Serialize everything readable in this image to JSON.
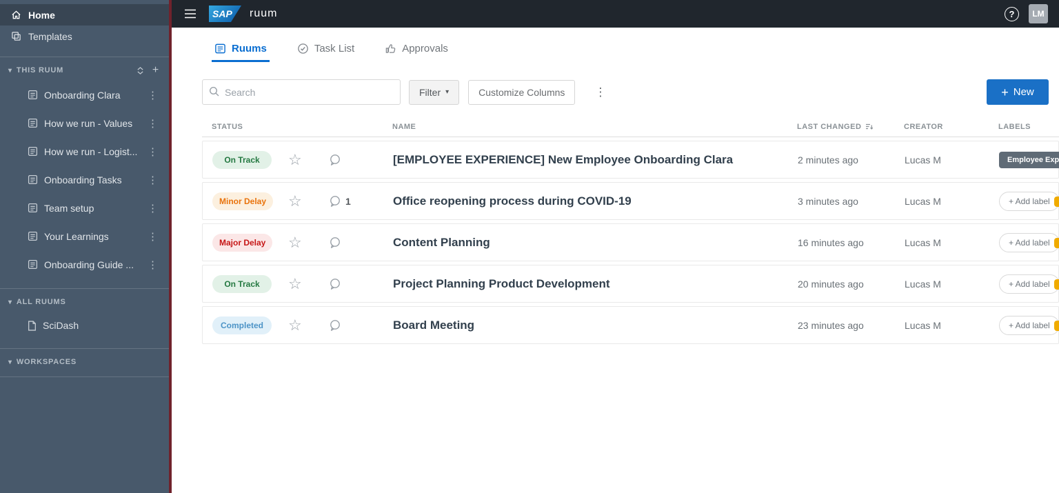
{
  "topbar": {
    "sap": "SAP",
    "product": "ruum",
    "help": "?",
    "avatar": "LM"
  },
  "sidebar": {
    "home": {
      "label": "Home"
    },
    "templates": {
      "label": "Templates"
    },
    "this_ruum": {
      "header": "THIS RUUM",
      "add": "+",
      "items": [
        {
          "label": "Onboarding Clara"
        },
        {
          "label": "How we run - Values"
        },
        {
          "label": "How we run - Logist..."
        },
        {
          "label": "Onboarding Tasks"
        },
        {
          "label": "Team setup"
        },
        {
          "label": "Your Learnings"
        },
        {
          "label": "Onboarding Guide ..."
        }
      ]
    },
    "all_ruums": {
      "header": "ALL RUUMS",
      "items": [
        {
          "label": "SciDash"
        }
      ]
    },
    "workspaces": {
      "header": "WORKSPACES"
    }
  },
  "tabs": [
    {
      "label": "Ruums",
      "active": true
    },
    {
      "label": "Task List",
      "active": false
    },
    {
      "label": "Approvals",
      "active": false
    }
  ],
  "toolbar": {
    "search_placeholder": "Search",
    "filter": "Filter",
    "customize": "Customize Columns",
    "new_plus": "+",
    "new": "New"
  },
  "table": {
    "headers": {
      "status": "STATUS",
      "name": "NAME",
      "last_changed": "LAST CHANGED",
      "creator": "CREATOR",
      "labels": "LABELS"
    },
    "rows": [
      {
        "status": "On Track",
        "status_type": "on-track",
        "comments": "",
        "name": "[EMPLOYEE EXPERIENCE] New Employee Onboarding Clara",
        "last_changed": "2 minutes ago",
        "creator": "Lucas M",
        "label": "Employee Expe",
        "label_type": "tag"
      },
      {
        "status": "Minor Delay",
        "status_type": "minor-delay",
        "comments": "1",
        "name": "Office reopening process during COVID-19",
        "last_changed": "3 minutes ago",
        "creator": "Lucas M",
        "label": "+ Add label",
        "label_type": "add"
      },
      {
        "status": "Major Delay",
        "status_type": "major-delay",
        "comments": "",
        "name": "Content Planning",
        "last_changed": "16 minutes ago",
        "creator": "Lucas M",
        "label": "+ Add label",
        "label_type": "add"
      },
      {
        "status": "On Track",
        "status_type": "on-track",
        "comments": "",
        "name": "Project Planning Product Development",
        "last_changed": "20 minutes ago",
        "creator": "Lucas M",
        "label": "+ Add label",
        "label_type": "add"
      },
      {
        "status": "Completed",
        "status_type": "completed",
        "comments": "",
        "name": "Board Meeting",
        "last_changed": "23 minutes ago",
        "creator": "Lucas M",
        "label": "+ Add label",
        "label_type": "add"
      }
    ]
  },
  "colors": {
    "accent_blue": "#0a6ed1",
    "new_button": "#1a70c6",
    "on_track_text": "#257942",
    "on_track_bg": "#e2f1e7",
    "minor_delay_text": "#e9730c",
    "minor_delay_bg": "#fcf0df",
    "major_delay_text": "#c61717",
    "major_delay_bg": "#fbe7e7",
    "completed_text": "#4d94c7",
    "completed_bg": "#e1f0f9",
    "sidebar_bg": "#48596b",
    "sidebar_accent_strip": "#70222c",
    "topbar_bg": "#20262d"
  }
}
